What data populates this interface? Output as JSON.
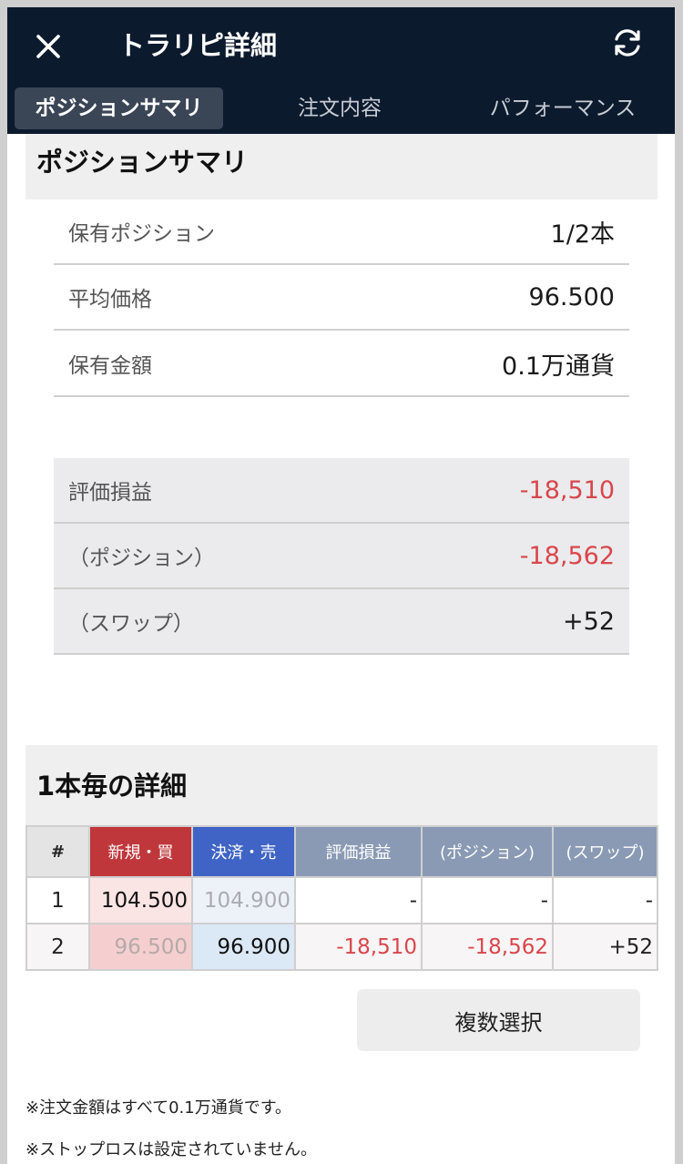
{
  "header": {
    "title": "トラリピ詳細",
    "tabs": [
      {
        "label": "ポジションサマリ",
        "active": true
      },
      {
        "label": "注文内容",
        "active": false
      },
      {
        "label": "パフォーマンス",
        "active": false
      }
    ]
  },
  "summary": {
    "title": "ポジションサマリ",
    "rows": [
      {
        "label": "保有ポジション",
        "value": "1/2本"
      },
      {
        "label": "平均価格",
        "value": "96.500"
      },
      {
        "label": "保有金額",
        "value": "0.1万通貨"
      }
    ],
    "pnl_rows": [
      {
        "label": "評価損益",
        "value": "-18,510"
      },
      {
        "label": "（ポジション）",
        "value": "-18,562"
      },
      {
        "label": "（スワップ）",
        "value": "+52"
      }
    ]
  },
  "detail": {
    "title": "1本毎の詳細",
    "columns": [
      "#",
      "新規・買",
      "決済・売",
      "評価損益",
      "(ポジション)",
      "(スワップ)"
    ],
    "rows": [
      [
        "1",
        "104.500",
        "104.900",
        "-",
        "-",
        "-"
      ],
      [
        "2",
        "96.500",
        "96.900",
        "-18,510",
        "-18,562",
        "+52"
      ]
    ]
  },
  "multi_select_label": "複数選択",
  "notes": [
    "※注文金額はすべて0.1万通貨です。",
    "※ストップロスは設定されていません。"
  ],
  "colors": {
    "header_bg": "#0c1a2e",
    "negative": "#d9464c",
    "buy": "#c0373b",
    "sell": "#3f64c6"
  }
}
